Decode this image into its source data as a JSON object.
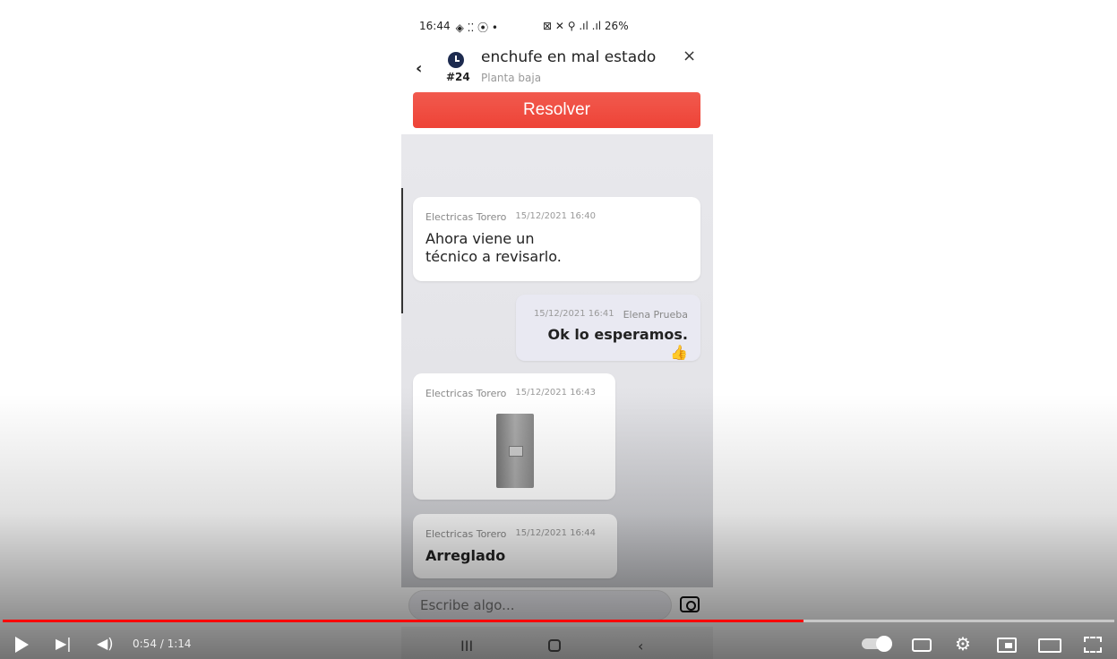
{
  "status_bar": {
    "time": "16:44",
    "left_icons": "◈ ⁚⁚ ⦿ •",
    "right_icons": "⊠ ✕ ⚲ .ıl .ıl 26%"
  },
  "ticket": {
    "number": "#24",
    "title": "enchufe en mal estado",
    "location": "Planta baja",
    "resolve_label": "Resolver"
  },
  "messages": [
    {
      "author": "Electricas Torero",
      "time": "15/12/2021 16:40",
      "text": "Ahora viene un técnico a revisarlo."
    },
    {
      "author": "Elena Prueba",
      "time": "15/12/2021 16:41",
      "text": "Ok lo esperamos. 👍"
    },
    {
      "author": "Electricas Torero",
      "time": "15/12/2021 16:43",
      "text": ""
    },
    {
      "author": "Electricas Torero",
      "time": "15/12/2021 16:44",
      "text": "Arreglado"
    }
  ],
  "composer": {
    "placeholder": "Escribe algo..."
  },
  "player": {
    "time_display": "0:54 / 1:14",
    "progress": 0.72,
    "accent": "#ff0000"
  },
  "icons": {
    "back": "‹",
    "close": "×",
    "nav_recent": "III",
    "nav_back": "‹",
    "next": "▶|",
    "volume": "◀)",
    "settings": "⚙"
  }
}
